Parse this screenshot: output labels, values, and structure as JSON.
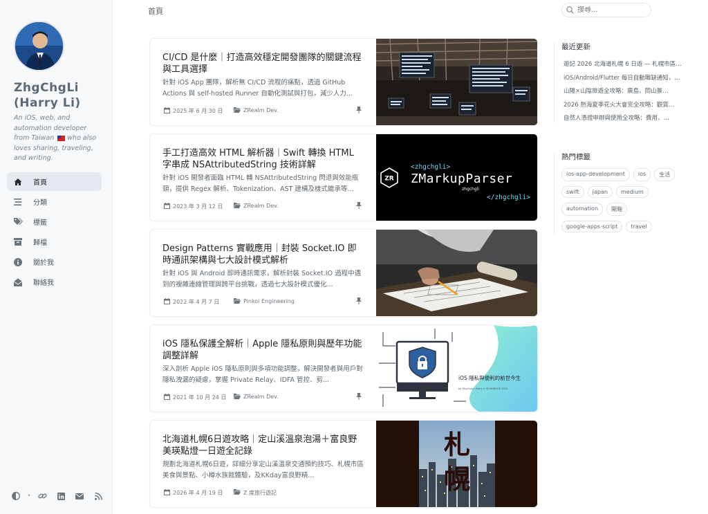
{
  "sidebar": {
    "title_line1": "ZhgChgLi",
    "title_line2": "(Harry Li)",
    "subtitle": "An iOS, web, and automation developer from Taiwan",
    "nav": [
      {
        "label": "首頁",
        "icon": "home-icon"
      },
      {
        "label": "分類",
        "icon": "stream-icon"
      },
      {
        "label": "標籤",
        "icon": "tags-icon"
      },
      {
        "label": "歸檔",
        "icon": "archive-icon"
      },
      {
        "label": "關於我",
        "icon": "info-circle-icon"
      },
      {
        "label": "聯絡我",
        "icon": "envelope-open-icon"
      }
    ],
    "subtitle2": "who also loves sharing, traveling, and writing."
  },
  "topbar": {
    "breadcrumb": "首頁",
    "search_placeholder": "搜尋..."
  },
  "posts": [
    {
      "title": "CI/CD 是什麼｜打造高效穩定開發團隊的關鍵流程與工具選擇",
      "description": "針對 iOS App 團隊，解析無 CI/CD 流程的痛點，透過 GitHub Actions 與 self-hosted Runner 自動化測試與打包，減少人力...",
      "date": "2025 年 6 月 30 日",
      "category": "ZRealm Dev.",
      "pinned": true
    },
    {
      "title": "手工打造高效 HTML 解析器｜Swift 轉換 HTML 字串成 NSAttributedString 技術詳解",
      "description": "針對 iOS 開發者面臨 HTML 轉 NSAttributedString 閃退與效能瓶頸，提供 Regex 解析、Tokenization、AST 建構及樣式繼承等...",
      "date": "2023 年 3 月 12 日",
      "category": "ZRealm Dev.",
      "pinned": true,
      "thumb_text": {
        "top": "<zhgchgli>",
        "main": "ZMarkupParser",
        "by": "zhgchgli",
        "bottom": "</zhgchgli>",
        "logo": "ZR"
      }
    },
    {
      "title": "Design Patterns 實戰應用｜封裝 Socket.IO 即時通訊架構與七大設計模式解析",
      "description": "針對 iOS 與 Android 即時通訊需求，解析封裝 Socket.IO 過程中遇到的複雜連線管理與跨平台挑戰，透過七大設計模式優化...",
      "date": "2022 年 4 月 7 日",
      "category": "Pinkoi Engineering",
      "pinned": true
    },
    {
      "title": "iOS 隱私保護全解析｜Apple 隱私原則與歷年功能調整詳解",
      "description": "深入剖析 Apple iOS 隱私原則與多項功能調整，解決開發者與用戶對隱私洩漏的疑慮，掌握 Private Relay、IDFA 管控、剪...",
      "date": "2021 年 10 月 24 日",
      "category": "ZRealm Dev.",
      "pinned": true,
      "thumb_text": {
        "main": "iOS 隱私與便利的前世今生",
        "by": "by ZhgChgLi, Harry Li @ MOBDOS 2021"
      }
    },
    {
      "title": "北海道札幌6日遊攻略｜定山溪溫泉泡湯＋富良野美瑛點燈一日遊全記錄",
      "description": "規劃北海道札幌6日遊，詳細分享定山溪溫泉交通預約技巧、札幌市區美食與景點、小樽水族館體驗，及KKday富良野精...",
      "date": "2026 年 4 月 19 日",
      "category": "Z 度旅行遊記",
      "pinned": false,
      "thumb_text": {
        "main": "札幌"
      }
    }
  ],
  "recent": {
    "heading": "最近更新",
    "items": [
      "遊記 2026 北海道札幌 6 日遊 — 札幌市區…",
      "iOS/Android/Flutter 每日自動職缺通知，…",
      "山陽×山陰旅遊全攻略：廣島、岡山景…",
      "2026 熱海夏季花火大會完全攻略：觀賞…",
      "自然人憑證申辦與使用全攻略：費用、…"
    ]
  },
  "popular_tags": {
    "heading": "熱門標籤",
    "tags": [
      "ios-app-development",
      "ios",
      "生活",
      "swift",
      "japan",
      "medium",
      "automation",
      "開箱",
      "google-apps-script",
      "travel"
    ]
  },
  "colors": {
    "sidebar_bg": "#f6f8fa",
    "active_nav": "#e5eaf0",
    "title": "#5b6a76"
  }
}
